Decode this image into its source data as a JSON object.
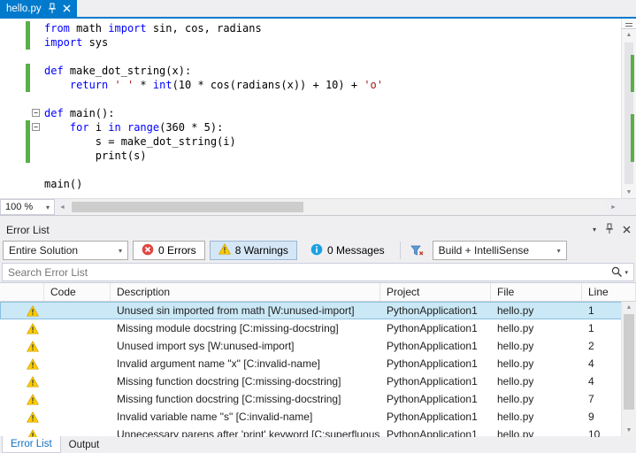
{
  "window": {
    "tab_title": "hello.py",
    "zoom_level": "100 %"
  },
  "colors": {
    "accent_blue": "#007ACC",
    "keyword_blue": "#0000FF",
    "string_red": "#A31515",
    "change_bar_green": "#5BAE4A",
    "warning_yellow": "#FFCC00",
    "error_red": "#E04743",
    "info_blue": "#1BA1E2",
    "selection_blue": "#CBE8F6",
    "active_tab_text_blue": "#0E70C0"
  },
  "editor": {
    "lines": [
      {
        "changed": true,
        "fold": false,
        "segments": [
          {
            "c": "kw",
            "t": "from"
          },
          {
            "c": "pl",
            "t": " math "
          },
          {
            "c": "kw",
            "t": "import"
          },
          {
            "c": "pl",
            "t": " sin, cos, radians"
          }
        ]
      },
      {
        "changed": true,
        "fold": false,
        "segments": [
          {
            "c": "kw",
            "t": "import"
          },
          {
            "c": "pl",
            "t": " sys"
          }
        ]
      },
      {
        "changed": false,
        "fold": false,
        "segments": []
      },
      {
        "changed": true,
        "fold": false,
        "segments": [
          {
            "c": "kw",
            "t": "def"
          },
          {
            "c": "pl",
            "t": " make_dot_string(x):"
          }
        ]
      },
      {
        "changed": true,
        "fold": false,
        "segments": [
          {
            "c": "pl",
            "t": "    "
          },
          {
            "c": "kw",
            "t": "return"
          },
          {
            "c": "pl",
            "t": " "
          },
          {
            "c": "str",
            "t": "' '"
          },
          {
            "c": "pl",
            "t": " * "
          },
          {
            "c": "kw",
            "t": "int"
          },
          {
            "c": "pl",
            "t": "(10 * cos(radians(x)) + 10) + "
          },
          {
            "c": "str",
            "t": "'o'"
          }
        ]
      },
      {
        "changed": false,
        "fold": false,
        "segments": []
      },
      {
        "changed": false,
        "fold": true,
        "segments": [
          {
            "c": "kw",
            "t": "def"
          },
          {
            "c": "pl",
            "t": " main():"
          }
        ]
      },
      {
        "changed": true,
        "fold": true,
        "segments": [
          {
            "c": "pl",
            "t": "    "
          },
          {
            "c": "kw",
            "t": "for"
          },
          {
            "c": "pl",
            "t": " i "
          },
          {
            "c": "kw",
            "t": "in"
          },
          {
            "c": "pl",
            "t": " "
          },
          {
            "c": "kw",
            "t": "range"
          },
          {
            "c": "pl",
            "t": "(360 * 5):"
          }
        ]
      },
      {
        "changed": true,
        "fold": false,
        "segments": [
          {
            "c": "pl",
            "t": "        s = make_dot_string(i)"
          }
        ]
      },
      {
        "changed": true,
        "fold": false,
        "segments": [
          {
            "c": "pl",
            "t": "        print(s)"
          }
        ]
      },
      {
        "changed": false,
        "fold": false,
        "segments": []
      },
      {
        "changed": false,
        "fold": false,
        "segments": [
          {
            "c": "pl",
            "t": "main()"
          }
        ]
      }
    ]
  },
  "error_list": {
    "title": "Error List",
    "scope_filter": "Entire Solution",
    "errors_button": "0 Errors",
    "warnings_button": "8 Warnings",
    "messages_button": "0 Messages",
    "source_filter": "Build + IntelliSense",
    "search_placeholder": "Search Error List",
    "columns": {
      "code": "Code",
      "description": "Description",
      "project": "Project",
      "file": "File",
      "line": "Line"
    },
    "rows": [
      {
        "severity": "warning",
        "code": "",
        "description": "Unused sin imported from math [W:unused-import]",
        "project": "PythonApplication1",
        "file": "hello.py",
        "line": "1",
        "selected": true
      },
      {
        "severity": "warning",
        "code": "",
        "description": "Missing module docstring [C:missing-docstring]",
        "project": "PythonApplication1",
        "file": "hello.py",
        "line": "1"
      },
      {
        "severity": "warning",
        "code": "",
        "description": "Unused import sys [W:unused-import]",
        "project": "PythonApplication1",
        "file": "hello.py",
        "line": "2"
      },
      {
        "severity": "warning",
        "code": "",
        "description": "Invalid argument name \"x\" [C:invalid-name]",
        "project": "PythonApplication1",
        "file": "hello.py",
        "line": "4"
      },
      {
        "severity": "warning",
        "code": "",
        "description": "Missing function docstring [C:missing-docstring]",
        "project": "PythonApplication1",
        "file": "hello.py",
        "line": "4"
      },
      {
        "severity": "warning",
        "code": "",
        "description": "Missing function docstring [C:missing-docstring]",
        "project": "PythonApplication1",
        "file": "hello.py",
        "line": "7"
      },
      {
        "severity": "warning",
        "code": "",
        "description": "Invalid variable name \"s\" [C:invalid-name]",
        "project": "PythonApplication1",
        "file": "hello.py",
        "line": "9"
      },
      {
        "severity": "warning",
        "code": "",
        "description": "Unnecessary parens after 'print' keyword [C:superfluous-parens]",
        "project": "PythonApplication1",
        "file": "hello.py",
        "line": "10"
      }
    ]
  },
  "bottom_tabs": {
    "error_list": "Error List",
    "output": "Output"
  }
}
